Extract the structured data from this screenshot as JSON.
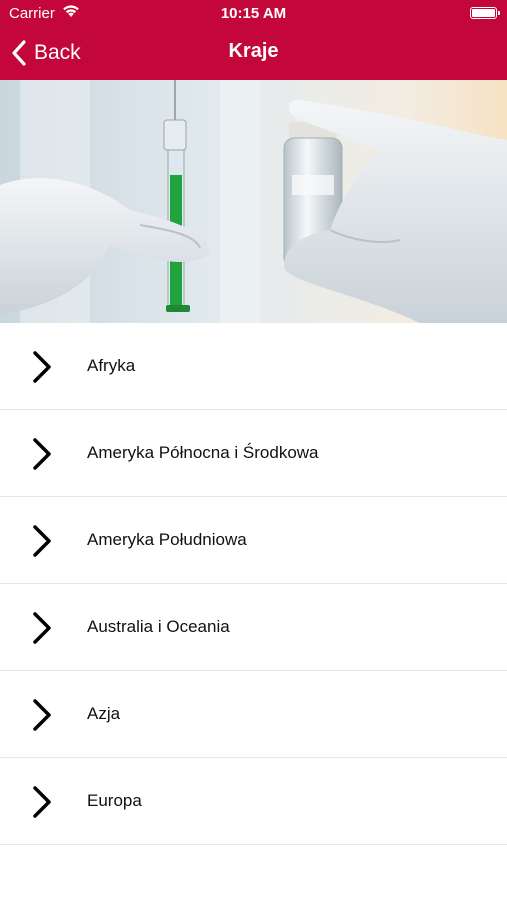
{
  "status_bar": {
    "carrier": "Carrier",
    "time": "10:15 AM"
  },
  "nav": {
    "back_label": "Back",
    "title": "Kraje"
  },
  "colors": {
    "header_bg": "#c3073a",
    "separator": "#e6e6e6"
  },
  "hero_image": "photo of gloved hands holding a syringe with green liquid and a vaccine vial",
  "regions": [
    {
      "label": "Afryka"
    },
    {
      "label": "Ameryka Północna i Środkowa"
    },
    {
      "label": "Ameryka Południowa"
    },
    {
      "label": "Australia i Oceania"
    },
    {
      "label": "Azja"
    },
    {
      "label": "Europa"
    }
  ]
}
